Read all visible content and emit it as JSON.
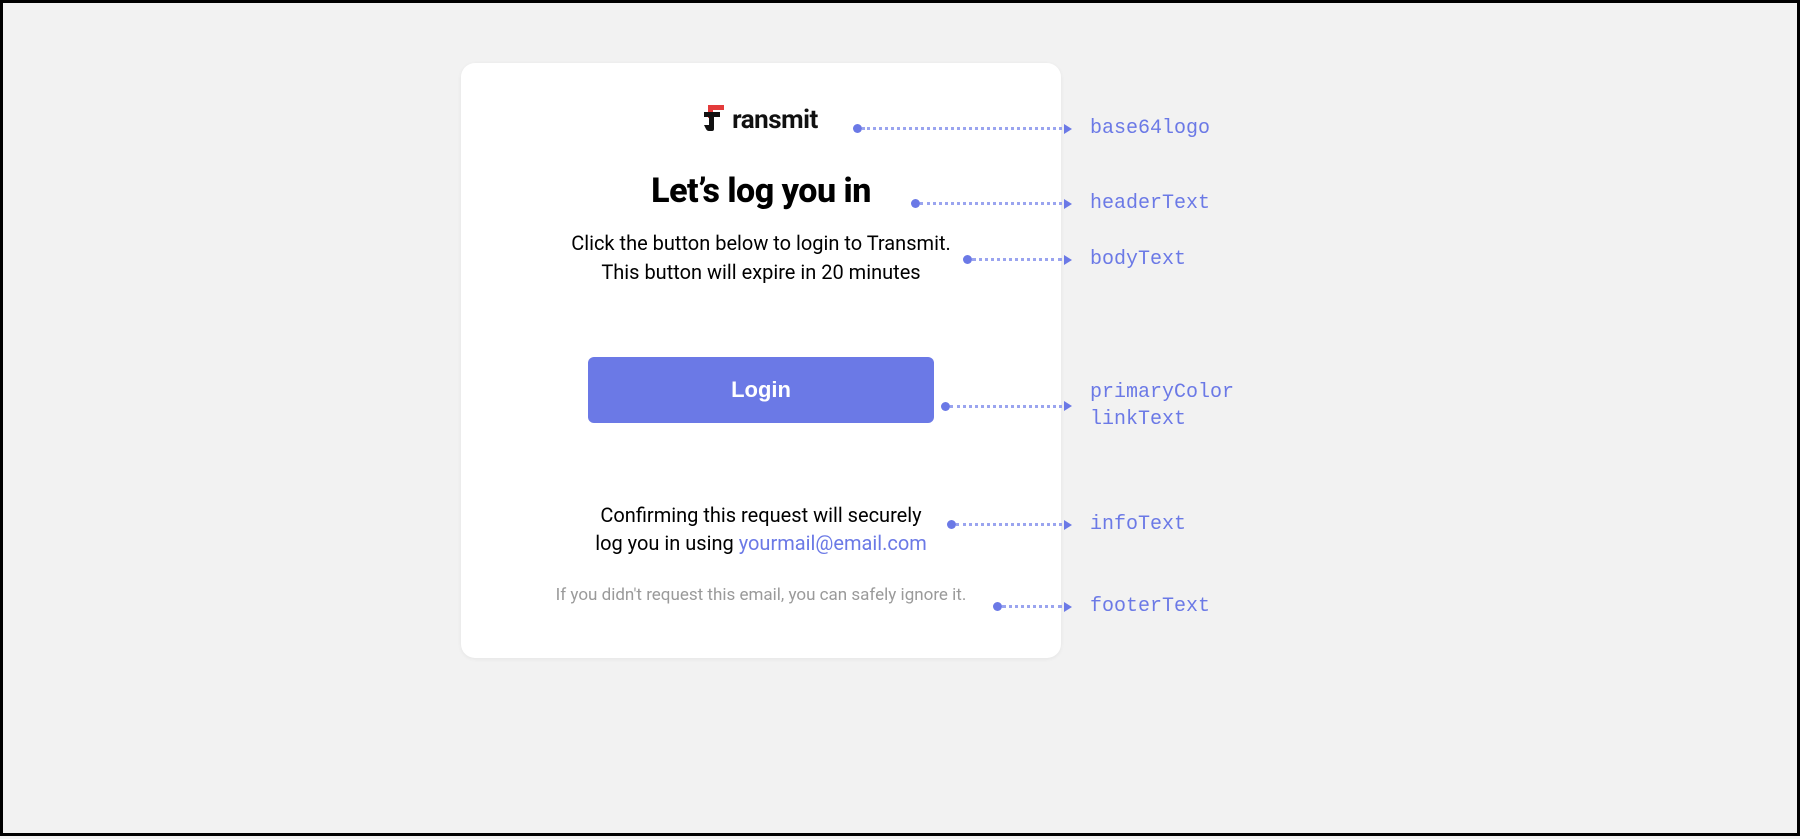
{
  "logo": {
    "word": "ransmit"
  },
  "header": "Let’s log you in",
  "body": {
    "line1": "Click the button below to login to Transmit.",
    "line2": "This button will expire in 20 minutes"
  },
  "button": {
    "label": "Login",
    "primaryColor": "#6b79e6"
  },
  "info": {
    "line1": "Confirming this request will securely",
    "line2_prefix": "log you in using ",
    "email": "yourmail@email.com"
  },
  "footer": "If you didn't request this email, you can safely ignore it.",
  "annotations": {
    "logo": "base64logo",
    "header": "headerText",
    "body": "bodyText",
    "buttonA": "primaryColor",
    "buttonB": "linkText",
    "info": "infoText",
    "footer": "footerText"
  }
}
